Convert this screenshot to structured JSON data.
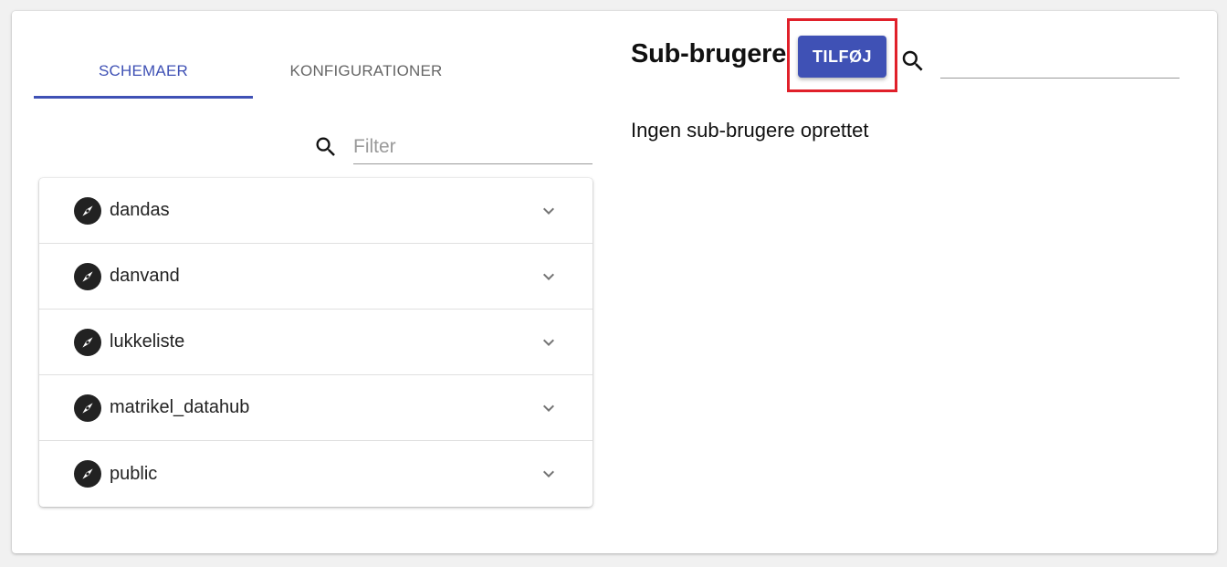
{
  "tabs": [
    {
      "label": "SCHEMAER",
      "active": true
    },
    {
      "label": "KONFIGURATIONER",
      "active": false
    }
  ],
  "filter": {
    "placeholder": "Filter",
    "value": ""
  },
  "schemas": [
    {
      "label": "dandas"
    },
    {
      "label": "danvand"
    },
    {
      "label": "lukkeliste"
    },
    {
      "label": "matrikel_datahub"
    },
    {
      "label": "public"
    }
  ],
  "subusers": {
    "title": "Sub-brugere",
    "add_label": "TILFØJ",
    "search_value": "",
    "empty_text": "Ingen sub-brugere oprettet"
  },
  "colors": {
    "accent": "#3f51b5",
    "highlight": "#e0202a"
  },
  "icons": {
    "schema": "compass-icon",
    "expand": "chevron-down-icon",
    "search": "search-icon"
  }
}
